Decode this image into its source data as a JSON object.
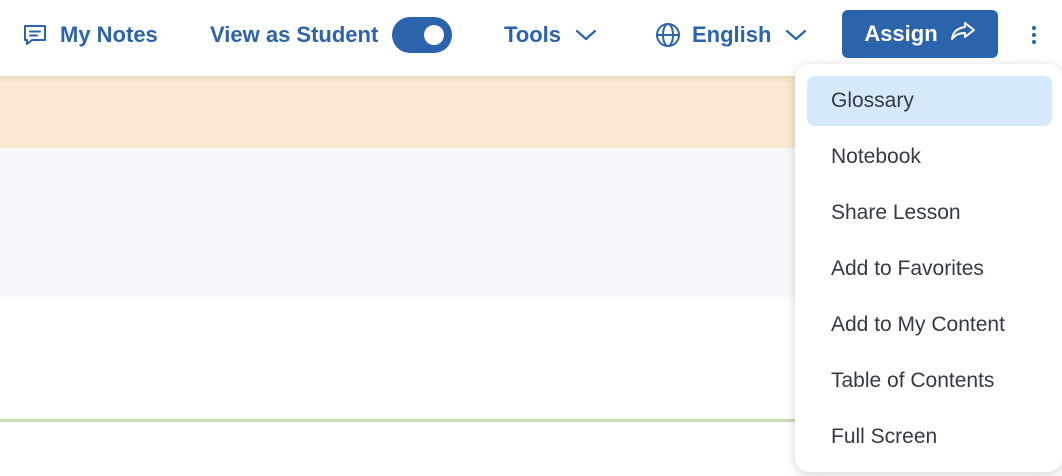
{
  "toolbar": {
    "notes_label": "My Notes",
    "view_as_student_label": "View as Student",
    "view_as_student_on": true,
    "tools_label": "Tools",
    "language_label": "English",
    "assign_label": "Assign"
  },
  "menu": {
    "items": [
      {
        "label": "Glossary",
        "active": true
      },
      {
        "label": "Notebook"
      },
      {
        "label": "Share Lesson"
      },
      {
        "label": "Add to Favorites"
      },
      {
        "label": "Add to My Content"
      },
      {
        "label": "Table of Contents"
      },
      {
        "label": "Full Screen"
      }
    ]
  },
  "colors": {
    "accent": "#2b64ad",
    "banner": "#fae9d0",
    "panel": "#f6f8fb",
    "menu_active": "#d6e8fb",
    "divider": "#c8dcb8"
  },
  "icons": [
    "chat-icon",
    "chevron-down-icon",
    "globe-icon",
    "share-arrow-icon",
    "kebab-menu-icon"
  ]
}
